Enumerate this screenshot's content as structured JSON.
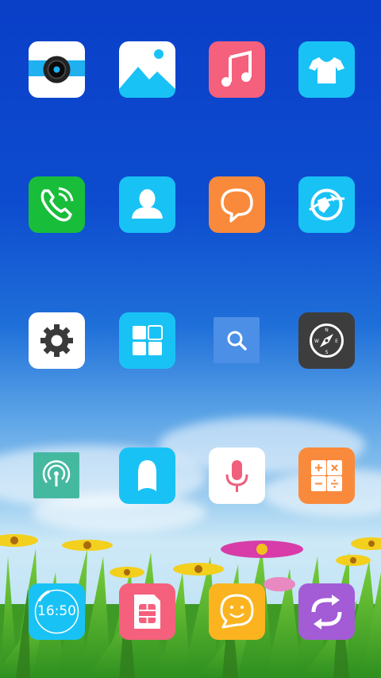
{
  "home_screen": {
    "apps": [
      {
        "name": "camera",
        "icon": "camera-icon",
        "color": "#ffffff"
      },
      {
        "name": "gallery",
        "icon": "gallery-icon",
        "color": "#ffffff"
      },
      {
        "name": "music",
        "icon": "music-note-icon",
        "color": "#f5607c"
      },
      {
        "name": "theme",
        "icon": "tshirt-icon",
        "color": "#19c2f5"
      },
      {
        "name": "phone",
        "icon": "phone-icon",
        "color": "#18bd3a"
      },
      {
        "name": "contacts",
        "icon": "contact-person-icon",
        "color": "#19c2f5"
      },
      {
        "name": "messages",
        "icon": "chat-bubble-icon",
        "color": "#f98a3c"
      },
      {
        "name": "browser",
        "icon": "globe-icon",
        "color": "#19c2f5"
      },
      {
        "name": "settings",
        "icon": "gear-icon",
        "color": "#ffffff"
      },
      {
        "name": "tools",
        "icon": "grid-tiles-icon",
        "color": "#19c2f5"
      },
      {
        "name": "search",
        "icon": "magnifier-icon",
        "color": "#4c8fe6"
      },
      {
        "name": "compass",
        "icon": "compass-icon",
        "color": "#3d3d3d"
      },
      {
        "name": "wireless",
        "icon": "signal-icon",
        "color": "#45b9a0"
      },
      {
        "name": "account",
        "icon": "account-head-icon",
        "color": "#19c2f5"
      },
      {
        "name": "recorder",
        "icon": "microphone-icon",
        "color": "#ffffff"
      },
      {
        "name": "calculator",
        "icon": "calculator-icon",
        "color": "#f98a3c"
      },
      {
        "name": "clock",
        "icon": "clock-icon",
        "color": "#19c2f5",
        "label": "16:50"
      },
      {
        "name": "sim-toolkit",
        "icon": "sim-card-icon",
        "color": "#f5607c"
      },
      {
        "name": "chat",
        "icon": "smiley-bubble-icon",
        "color": "#fbb41f"
      },
      {
        "name": "sync",
        "icon": "refresh-arrows-icon",
        "color": "#a35bd6"
      }
    ]
  }
}
